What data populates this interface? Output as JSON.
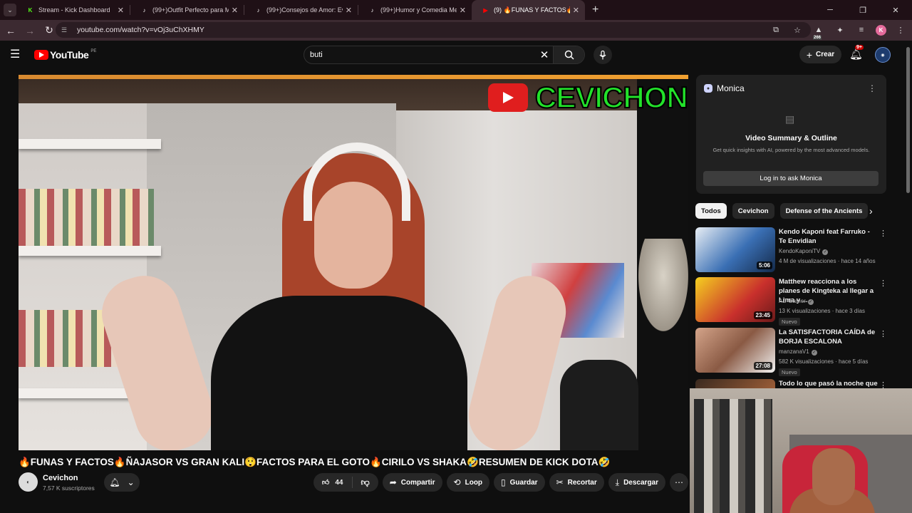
{
  "browser": {
    "tabs": [
      {
        "label": "Stream - Kick Dashboard",
        "favicon": "kick-icon",
        "color": "#53fc18",
        "glyph": "K"
      },
      {
        "label": "(99+)Outfit Perfecto para Mi Cu",
        "favicon": "tiktok-icon",
        "color": "#ffffff",
        "glyph": "♪"
      },
      {
        "label": "(99+)Consejos de Amor: Evita C",
        "favicon": "tiktok-icon",
        "color": "#ffffff",
        "glyph": "♪"
      },
      {
        "label": "(99+)Humor y Comedia Mexica",
        "favicon": "tiktok-icon",
        "color": "#ffffff",
        "glyph": "♪"
      },
      {
        "label": "(9) 🔥FUNAS Y FACTOS🔥Ñ",
        "favicon": "youtube-icon",
        "color": "#ff0000",
        "glyph": "▶",
        "active": true
      }
    ],
    "url": "youtube.com/watch?v=vOj3uChXHMY",
    "extension_badge": "266",
    "profile_initial": "K"
  },
  "youtube": {
    "logo_text": "YouTube",
    "region": "PE",
    "search_query": "buti",
    "create_label": "Crear",
    "notif_count": "9+"
  },
  "video": {
    "overlay_text": "CEVICHON",
    "title": "🔥FUNAS Y FACTOS🔥ÑAJASOR VS GRAN KALI😲FACTOS PARA EL GOTO🔥CIRILO VS SHAKA🤣RESUMEN DE KICK DOTA🤣",
    "channel": "Cevichon",
    "subscribers": "7,57 K suscriptores",
    "likes": "44",
    "share": "Compartir",
    "loop": "Loop",
    "save": "Guardar",
    "clip": "Recortar",
    "download": "Descargar"
  },
  "monica": {
    "name": "Monica",
    "title": "Video Summary & Outline",
    "subtitle": "Get quick insights with AI, powered by the most advanced models.",
    "button": "Log in to ask Monica"
  },
  "chips": [
    "Todos",
    "Cevichon",
    "Defense of the Ancients"
  ],
  "recommendations": [
    {
      "title": "Kendo Kaponi feat Farruko - Te Envidian",
      "channel": "KendoKaponiTV",
      "meta": "4 M de visualizaciones · hace 14 años",
      "duration": "5:06",
      "new": "",
      "thumb": "linear-gradient(135deg,#e8eef4,#3a6fb4 55%,#142a4a)"
    },
    {
      "title": "Matthew reacciona a los planes de Kingteka al llegar a Lima y ...",
      "channel": "AD Gamer",
      "meta": "13 K visualizaciones · hace 3 días",
      "duration": "23:45",
      "new": "Nuevo",
      "thumb": "linear-gradient(135deg,#f5d020,#c9302c 60%,#6a1a1a)"
    },
    {
      "title": "La SATISFACTORIA CAÍDA de BORJA ESCALONA",
      "channel": "manzanaV1",
      "meta": "582 K visualizaciones · hace 5 días",
      "duration": "27:08",
      "new": "Nuevo",
      "thumb": "linear-gradient(135deg,#d4a48a,#8a5a44 50%,#f2f2f2)"
    },
    {
      "title": "Todo lo que pasó la noche que",
      "channel": "",
      "meta": "",
      "duration": "",
      "new": "",
      "thumb": "linear-gradient(135deg,#3a2a20,#c07040)"
    }
  ]
}
